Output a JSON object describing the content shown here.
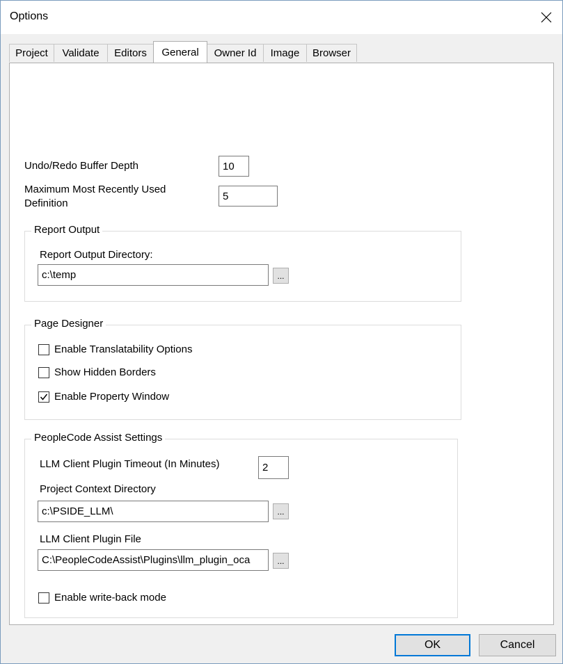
{
  "window": {
    "title": "Options"
  },
  "tabs": [
    {
      "label": "Project"
    },
    {
      "label": "Validate"
    },
    {
      "label": "Editors"
    },
    {
      "label": "General",
      "active": true
    },
    {
      "label": "Owner Id"
    },
    {
      "label": "Image"
    },
    {
      "label": "Browser"
    }
  ],
  "general": {
    "undo_label": "Undo/Redo Buffer Depth",
    "undo_value": "10",
    "mru_label_line1": "Maximum Most Recently Used",
    "mru_label_line2": "Definition",
    "mru_value": "5"
  },
  "report_output": {
    "title": "Report Output",
    "dir_label": "Report Output Directory:",
    "dir_value": "c:\\temp",
    "browse_label": "..."
  },
  "page_designer": {
    "title": "Page Designer",
    "options": [
      {
        "label": "Enable Translatability Options",
        "checked": false
      },
      {
        "label": "Show Hidden Borders",
        "checked": false
      },
      {
        "label": "Enable Property Window",
        "checked": true
      }
    ]
  },
  "peoplecode_assist": {
    "title": "PeopleCode Assist Settings",
    "timeout_label": "LLM Client Plugin Timeout (In Minutes)",
    "timeout_value": "2",
    "context_label": "Project Context Directory",
    "context_value": "c:\\PSIDE_LLM\\",
    "plugin_label": "LLM Client Plugin File",
    "plugin_value": "C:\\PeopleCodeAssist\\Plugins\\llm_plugin_oca",
    "browse_label": "...",
    "writeback_label": "Enable write-back mode",
    "writeback_checked": false
  },
  "buttons": {
    "ok": "OK",
    "cancel": "Cancel"
  },
  "colors": {
    "accent": "#0078d7"
  }
}
